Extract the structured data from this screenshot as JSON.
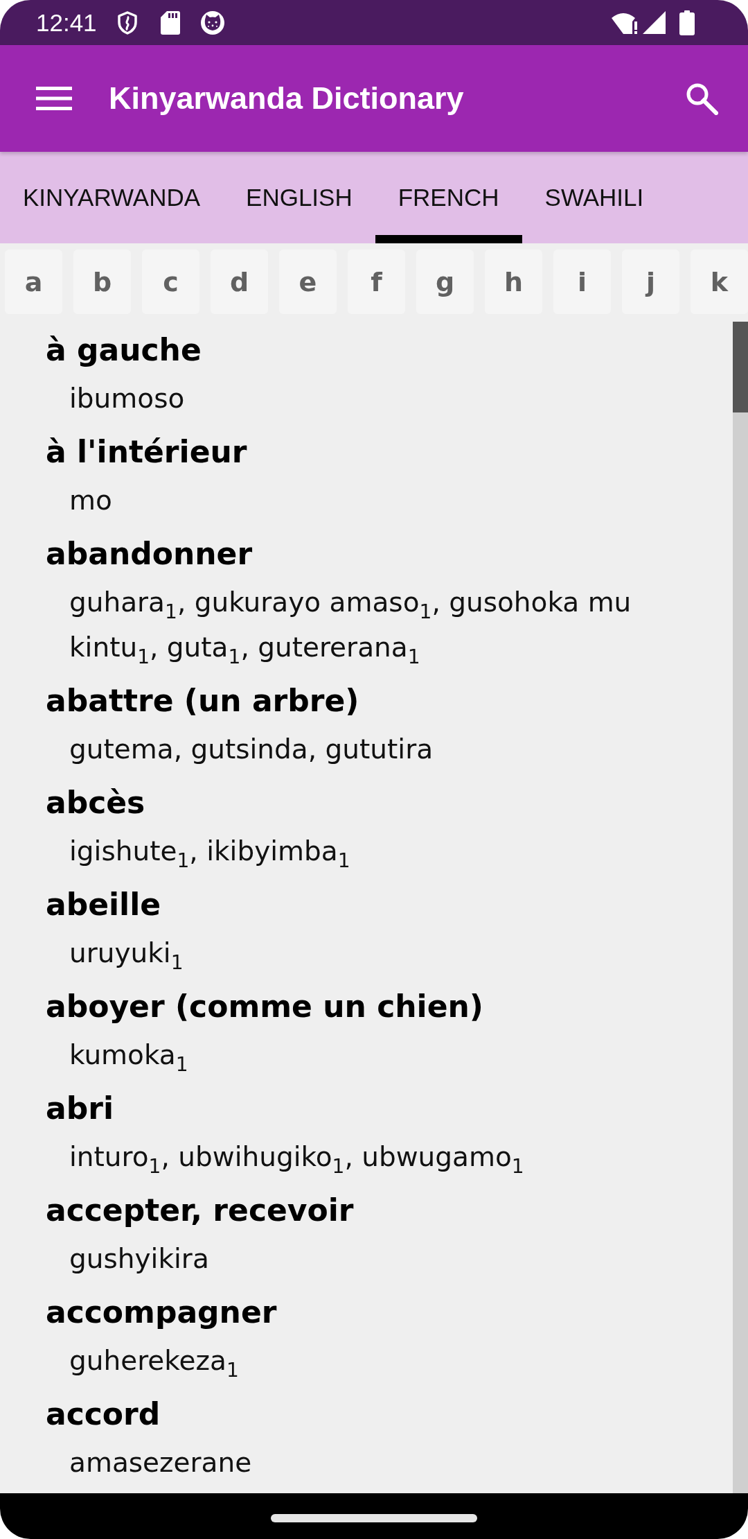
{
  "status_bar": {
    "time": "12:41"
  },
  "app_bar": {
    "title": "Kinyarwanda Dictionary"
  },
  "tabs": [
    {
      "label": "KINYARWANDA",
      "selected": false
    },
    {
      "label": "ENGLISH",
      "selected": false
    },
    {
      "label": "FRENCH",
      "selected": true
    },
    {
      "label": "SWAHILI",
      "selected": false
    }
  ],
  "letters": [
    "a",
    "b",
    "c",
    "d",
    "e",
    "f",
    "g",
    "h",
    "i",
    "j",
    "k"
  ],
  "entries": [
    {
      "term": "à gauche",
      "translation": "ibumoso"
    },
    {
      "term": "à l'intérieur",
      "translation": "mo"
    },
    {
      "term": "abandonner",
      "translation": "guhara$_{1}$, gukurayo amaso$_{1}$, gusohoka mu kintu$_{1}$, guta$_{1}$, gutererana$_{1}$"
    },
    {
      "term": "abattre (un arbre)",
      "translation": "gutema, gutsinda, gututira"
    },
    {
      "term": "abcès",
      "translation": "igishute$_{1}$, ikibyimba$_{1}$"
    },
    {
      "term": "abeille",
      "translation": "uruyuki$_{1}$"
    },
    {
      "term": "aboyer (comme un chien)",
      "translation": "kumoka$_{1}$"
    },
    {
      "term": "abri",
      "translation": "inturo$_{1}$, ubwihugiko$_{1}$, ubwugamo$_{1}$"
    },
    {
      "term": "accepter, recevoir",
      "translation": "gushyikira"
    },
    {
      "term": "accompagner",
      "translation": "guherekeza$_{1}$"
    },
    {
      "term": "accord",
      "translation": "amasezerane"
    }
  ]
}
